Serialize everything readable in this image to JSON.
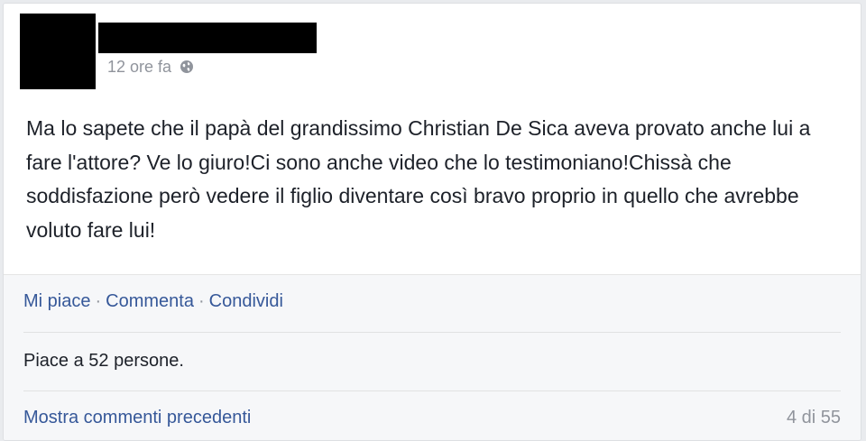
{
  "post": {
    "timestamp": "12 ore fa",
    "privacy_icon": "globe-icon",
    "text": "Ma lo sapete che il papà del grandissimo Christian De Sica aveva provato anche lui a fare l'attore? Ve lo giuro!Ci sono anche video che lo testimoniano!Chissà che soddisfazione però vedere il figlio diventare così bravo proprio in quello che avrebbe voluto fare lui!"
  },
  "actions": {
    "like": "Mi piace",
    "comment": "Commenta",
    "share": "Condividi",
    "separator": "·"
  },
  "likes_text": "Piace a 52 persone.",
  "comments": {
    "show_previous": "Mostra commenti precedenti",
    "counter": "4 di 55"
  },
  "colors": {
    "link": "#365899",
    "text": "#1d2129",
    "muted": "#90949c",
    "action_background": "#f6f7f9"
  }
}
